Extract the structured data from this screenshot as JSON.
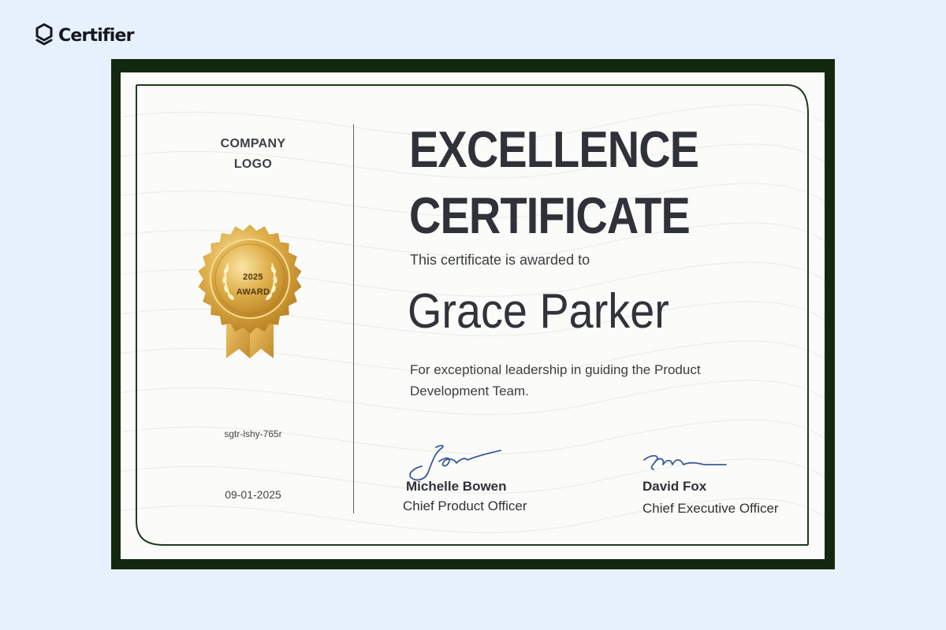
{
  "brand": {
    "name": "Certifier",
    "icon": "certifier-logo-icon"
  },
  "certificate": {
    "company_logo_line1": "COMPANY",
    "company_logo_line2": "LOGO",
    "seal": {
      "icon": "gold-award-seal-icon",
      "year": "2025",
      "label": "AWARD"
    },
    "certificate_id": "sgtr-lshy-765r",
    "date": "09-01-2025",
    "title_line1": "EXCELLENCE",
    "title_line2": "CERTIFICATE",
    "awarded_to": "This certificate is awarded to",
    "recipient": "Grace Parker",
    "reason": "For exceptional leadership in guiding the Product Development Team.",
    "signatories": [
      {
        "name": "Michelle Bowen",
        "role": "Chief Product Officer"
      },
      {
        "name": "David Fox",
        "role": "Chief Executive Officer"
      }
    ]
  },
  "colors": {
    "page_background": "#e6f1fd",
    "frame": "#13290f",
    "paper": "#fbfbf9",
    "gold": "#d9a63a",
    "ink_blue": "#3c5a9a",
    "text_dark": "#2f3238"
  }
}
